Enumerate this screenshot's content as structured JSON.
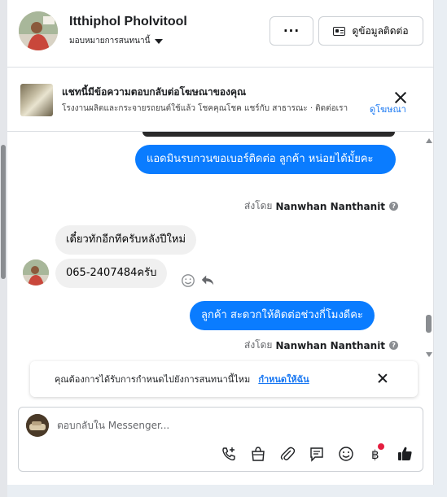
{
  "header": {
    "name": "Itthiphol Pholvitool",
    "assign_label": "มอบหมายการสนทนานี้",
    "more_label": "···",
    "contact_label": "ดูข้อมูลติดต่อ"
  },
  "ad_banner": {
    "title": "แชทนี้มีข้อความตอบกลับต่อโฆษณาของคุณ",
    "description": "โรงงานผลิตและกระจายรถยนต์ใช้แล้ว โชคคุณโชค แชร์กับ สาธารณะ · ติดต่อเรา",
    "link_label": "ดูโฆษณา"
  },
  "messages": [
    {
      "direction": "out",
      "text": "แอดมินรบกวนขอเบอร์ติดต่อ ลูกค้า  หน่อยได้มั้ยคะ",
      "sent_by_prefix": "ส่งโดย",
      "sent_by_name": "Nanwhan Nanthanit"
    },
    {
      "direction": "in",
      "text": "เดี๋ยวทักอีกทีครับหลังปีใหม่"
    },
    {
      "direction": "in",
      "text": "065-2407484ครับ"
    },
    {
      "direction": "out",
      "text": "ลูกค้า สะดวกให้ติดต่อช่วงกี่โมงดีคะ",
      "sent_by_prefix": "ส่งโดย",
      "sent_by_name": "Nanwhan Nanthanit"
    }
  ],
  "help_mark": "?",
  "notification": {
    "text": "คุณต้องการได้รับการกำหนดไปยังการสนทนานี้ไหม",
    "link_label": "กำหนดให้ฉัน"
  },
  "composer": {
    "placeholder": "ตอบกลับใน Messenger...",
    "tools": [
      "phone-add-icon",
      "shopping-bag-icon",
      "paperclip-icon",
      "saved-reply-icon",
      "emoji-icon",
      "baht-icon",
      "thumbs-up-icon"
    ],
    "accent_color": "#0a7cff",
    "badge_color": "#e41e3f"
  }
}
